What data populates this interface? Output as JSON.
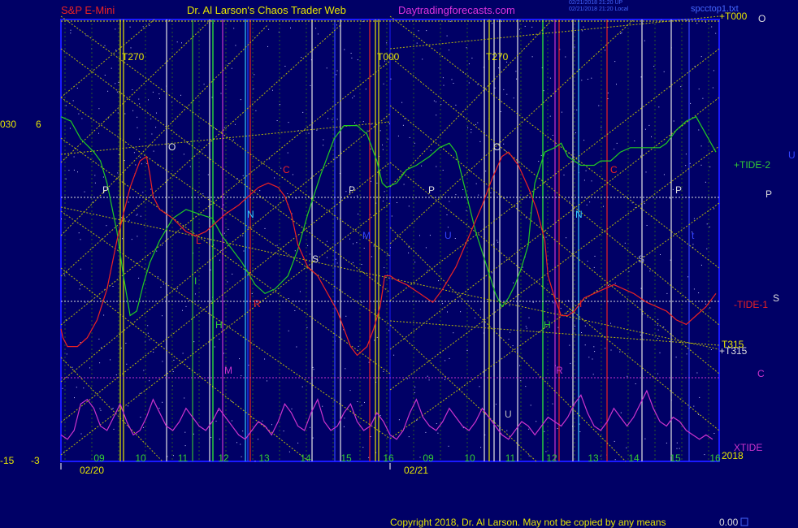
{
  "header": {
    "left_title": "S&P E-Mini",
    "center_title": "Dr. Al Larson's Chaos Trader Web",
    "site": "Daytradingforecasts.com",
    "stamp_1": "02/21/2018 21:20 UP",
    "stamp_2": "02/21/2018 21:20 Local",
    "file_name": "spcctop1.txt"
  },
  "colors": {
    "background": "#000066",
    "frame_blue": "#1a1aff",
    "tide2": "#22cc22",
    "tide1": "#ee2222",
    "xtide": "#cc33cc",
    "grid_line": "#cccc00",
    "white_line": "#e6e6e6",
    "label_yellow": "#e6e600"
  },
  "chart_data": {
    "type": "line",
    "title": "S&P E-Mini",
    "left_axis_labels": {
      "top_a": "030",
      "top_b": "6",
      "bottom_a": "-15",
      "bottom_b": "-3"
    },
    "date_labels": [
      "02/20",
      "02/21"
    ],
    "x_ticks": [
      "09",
      "10",
      "11",
      "12",
      "13",
      "14",
      "15",
      "16",
      "09",
      "10",
      "11",
      "12",
      "13",
      "14",
      "15",
      "16"
    ],
    "x_range": [
      0,
      100
    ],
    "y_range": [
      0,
      100
    ],
    "series": [
      {
        "name": "+TIDE-2",
        "color": "#22cc22",
        "values": [
          [
            0,
            78
          ],
          [
            1.5,
            77
          ],
          [
            3,
            73
          ],
          [
            5,
            70
          ],
          [
            6,
            68
          ],
          [
            7,
            63
          ],
          [
            8.5,
            52
          ],
          [
            9.5,
            42
          ],
          [
            10.5,
            33
          ],
          [
            11.5,
            34
          ],
          [
            12.5,
            40
          ],
          [
            13.5,
            45
          ],
          [
            15,
            50
          ],
          [
            17,
            55
          ],
          [
            19,
            57
          ],
          [
            21,
            56
          ],
          [
            23,
            55
          ],
          [
            24.5,
            51
          ],
          [
            27.5,
            45
          ],
          [
            29.5,
            40
          ],
          [
            31,
            38
          ],
          [
            32.5,
            39
          ],
          [
            34.5,
            42
          ],
          [
            36,
            48
          ],
          [
            37.5,
            56
          ],
          [
            39.5,
            65
          ],
          [
            41.5,
            73
          ],
          [
            43,
            76
          ],
          [
            45,
            76
          ],
          [
            46.5,
            74
          ],
          [
            48,
            68
          ],
          [
            48.8,
            63
          ],
          [
            49.5,
            62
          ],
          [
            51,
            63
          ],
          [
            52.5,
            66
          ],
          [
            54,
            67
          ],
          [
            56,
            69
          ],
          [
            57.5,
            71
          ],
          [
            59,
            72
          ],
          [
            60,
            70
          ],
          [
            61,
            64
          ],
          [
            62,
            58
          ],
          [
            63,
            52
          ],
          [
            64.5,
            45
          ],
          [
            66,
            38
          ],
          [
            67,
            35
          ],
          [
            68,
            37
          ],
          [
            69,
            40
          ],
          [
            70,
            44
          ],
          [
            71,
            49
          ],
          [
            71.5,
            57
          ],
          [
            72,
            63
          ],
          [
            73.5,
            70
          ],
          [
            75,
            71
          ],
          [
            76,
            72
          ],
          [
            77,
            69
          ],
          [
            78,
            68
          ],
          [
            79,
            67
          ],
          [
            80,
            67
          ],
          [
            81,
            67
          ],
          [
            82,
            68
          ],
          [
            83.5,
            68
          ],
          [
            85,
            70
          ],
          [
            86.5,
            71
          ],
          [
            88,
            71
          ],
          [
            89.5,
            71
          ],
          [
            91,
            71
          ],
          [
            92,
            72
          ],
          [
            93.5,
            75
          ],
          [
            95,
            77
          ],
          [
            96.5,
            78
          ],
          [
            98,
            74
          ],
          [
            99.5,
            70
          ]
        ],
        "label": "+TIDE-2"
      },
      {
        "name": "-TIDE-1",
        "color": "#ee2222",
        "values": [
          [
            0,
            30
          ],
          [
            0.3,
            28
          ],
          [
            1,
            26
          ],
          [
            2.5,
            26
          ],
          [
            4,
            28
          ],
          [
            5.5,
            32
          ],
          [
            7,
            39
          ],
          [
            8.5,
            50
          ],
          [
            9.5,
            56
          ],
          [
            10.5,
            62
          ],
          [
            12,
            68
          ],
          [
            13,
            69
          ],
          [
            13.5,
            65
          ],
          [
            14,
            60
          ],
          [
            15,
            57
          ],
          [
            17,
            55
          ],
          [
            19,
            52
          ],
          [
            20.5,
            51
          ],
          [
            22,
            52
          ],
          [
            23.5,
            54
          ],
          [
            25,
            56
          ],
          [
            27,
            58
          ],
          [
            28.5,
            60
          ],
          [
            30,
            62
          ],
          [
            31.5,
            63
          ],
          [
            33,
            62
          ],
          [
            34,
            60
          ],
          [
            35,
            56
          ],
          [
            36,
            49
          ],
          [
            37.5,
            44
          ],
          [
            39,
            42
          ],
          [
            40.5,
            38
          ],
          [
            42,
            34
          ],
          [
            43,
            30
          ],
          [
            44,
            26
          ],
          [
            45,
            24
          ],
          [
            46.5,
            26
          ],
          [
            47.5,
            30
          ],
          [
            48.5,
            35
          ],
          [
            49.2,
            42
          ],
          [
            50,
            42
          ],
          [
            51,
            41
          ],
          [
            52.5,
            40
          ],
          [
            54.5,
            38
          ],
          [
            55.5,
            37
          ],
          [
            56.5,
            36
          ],
          [
            58,
            39
          ],
          [
            60,
            44
          ],
          [
            62,
            51
          ],
          [
            64,
            58
          ],
          [
            65.5,
            64
          ],
          [
            67,
            69
          ],
          [
            68,
            70
          ],
          [
            69.5,
            67
          ],
          [
            71,
            62
          ],
          [
            72.3,
            57
          ],
          [
            73.5,
            50
          ],
          [
            74,
            42
          ],
          [
            75,
            37
          ],
          [
            76,
            33
          ],
          [
            77,
            33
          ],
          [
            78,
            34
          ],
          [
            79.5,
            37
          ],
          [
            81,
            38
          ],
          [
            82.5,
            39
          ],
          [
            84,
            40
          ],
          [
            85.5,
            39
          ],
          [
            87,
            38
          ],
          [
            89,
            36
          ],
          [
            90.5,
            35
          ],
          [
            92,
            34
          ],
          [
            93.5,
            32
          ],
          [
            95,
            31
          ],
          [
            96.5,
            33
          ],
          [
            98,
            35
          ],
          [
            99.5,
            38
          ]
        ],
        "label": "-TIDE-1"
      },
      {
        "name": "XTIDE",
        "color": "#cc33cc",
        "values": [
          [
            0,
            6
          ],
          [
            1,
            5
          ],
          [
            2,
            7
          ],
          [
            3,
            13
          ],
          [
            4,
            14
          ],
          [
            5,
            12
          ],
          [
            6,
            8
          ],
          [
            7,
            7
          ],
          [
            8,
            10
          ],
          [
            9,
            13
          ],
          [
            10,
            9
          ],
          [
            11,
            6
          ],
          [
            12,
            7
          ],
          [
            13,
            10
          ],
          [
            14,
            14
          ],
          [
            15,
            11
          ],
          [
            16,
            8
          ],
          [
            17,
            7
          ],
          [
            18,
            9
          ],
          [
            19,
            12
          ],
          [
            20,
            10
          ],
          [
            21,
            8
          ],
          [
            22,
            7
          ],
          [
            23,
            9
          ],
          [
            24,
            12
          ],
          [
            25,
            10
          ],
          [
            26,
            8
          ],
          [
            27,
            6
          ],
          [
            28,
            5
          ],
          [
            29,
            7
          ],
          [
            30,
            9
          ],
          [
            31,
            8
          ],
          [
            32,
            6
          ],
          [
            33,
            9
          ],
          [
            34,
            13
          ],
          [
            35,
            11
          ],
          [
            36,
            8
          ],
          [
            37,
            7
          ],
          [
            38,
            11
          ],
          [
            39,
            14
          ],
          [
            40,
            9
          ],
          [
            41,
            7
          ],
          [
            42,
            8
          ],
          [
            43,
            11
          ],
          [
            44,
            13
          ],
          [
            45,
            9
          ],
          [
            46,
            7
          ],
          [
            47,
            8
          ],
          [
            48,
            11
          ],
          [
            49,
            9
          ],
          [
            50,
            6
          ],
          [
            51,
            5
          ],
          [
            52,
            7
          ],
          [
            53,
            11
          ],
          [
            54,
            14
          ],
          [
            55,
            10
          ],
          [
            56,
            8
          ],
          [
            57,
            7
          ],
          [
            58,
            9
          ],
          [
            59,
            12
          ],
          [
            60,
            10
          ],
          [
            61,
            8
          ],
          [
            62,
            7
          ],
          [
            63,
            9
          ],
          [
            64,
            12
          ],
          [
            65,
            10
          ],
          [
            66,
            8
          ],
          [
            67,
            6
          ],
          [
            68,
            5
          ],
          [
            69,
            7
          ],
          [
            70,
            9
          ],
          [
            71,
            8
          ],
          [
            72,
            6
          ],
          [
            73,
            8
          ],
          [
            74,
            10
          ],
          [
            75,
            9
          ],
          [
            76,
            8
          ],
          [
            77,
            10
          ],
          [
            78,
            13
          ],
          [
            79,
            15
          ],
          [
            80,
            11
          ],
          [
            81,
            8
          ],
          [
            82,
            7
          ],
          [
            83,
            9
          ],
          [
            84,
            12
          ],
          [
            85,
            10
          ],
          [
            86,
            8
          ],
          [
            87,
            10
          ],
          [
            88,
            13
          ],
          [
            89,
            16
          ],
          [
            90,
            12
          ],
          [
            91,
            9
          ],
          [
            92,
            8
          ],
          [
            93,
            10
          ],
          [
            94,
            9
          ],
          [
            95,
            7
          ],
          [
            96,
            6
          ],
          [
            97,
            5
          ],
          [
            98,
            6
          ],
          [
            99,
            5
          ]
        ],
        "label": "XTIDE"
      }
    ],
    "right_labels": [
      "+T000",
      "O",
      "U",
      "P",
      "S",
      "T315",
      "+T315",
      "C",
      "2018"
    ],
    "cycle_labels": [
      "T270",
      "T000",
      "T270"
    ],
    "point_labels": [
      "P",
      "O",
      "C",
      "N",
      "S",
      "P",
      "I",
      "H",
      "R",
      "M",
      "L",
      "P",
      "O",
      "C",
      "N",
      "S",
      "P",
      "I",
      "H",
      "R",
      "M",
      "U",
      "U",
      "t"
    ],
    "copyright": "Copyright 2018, Dr. Al Larson. May not be copied by any means",
    "bottom_value": "0.00"
  }
}
